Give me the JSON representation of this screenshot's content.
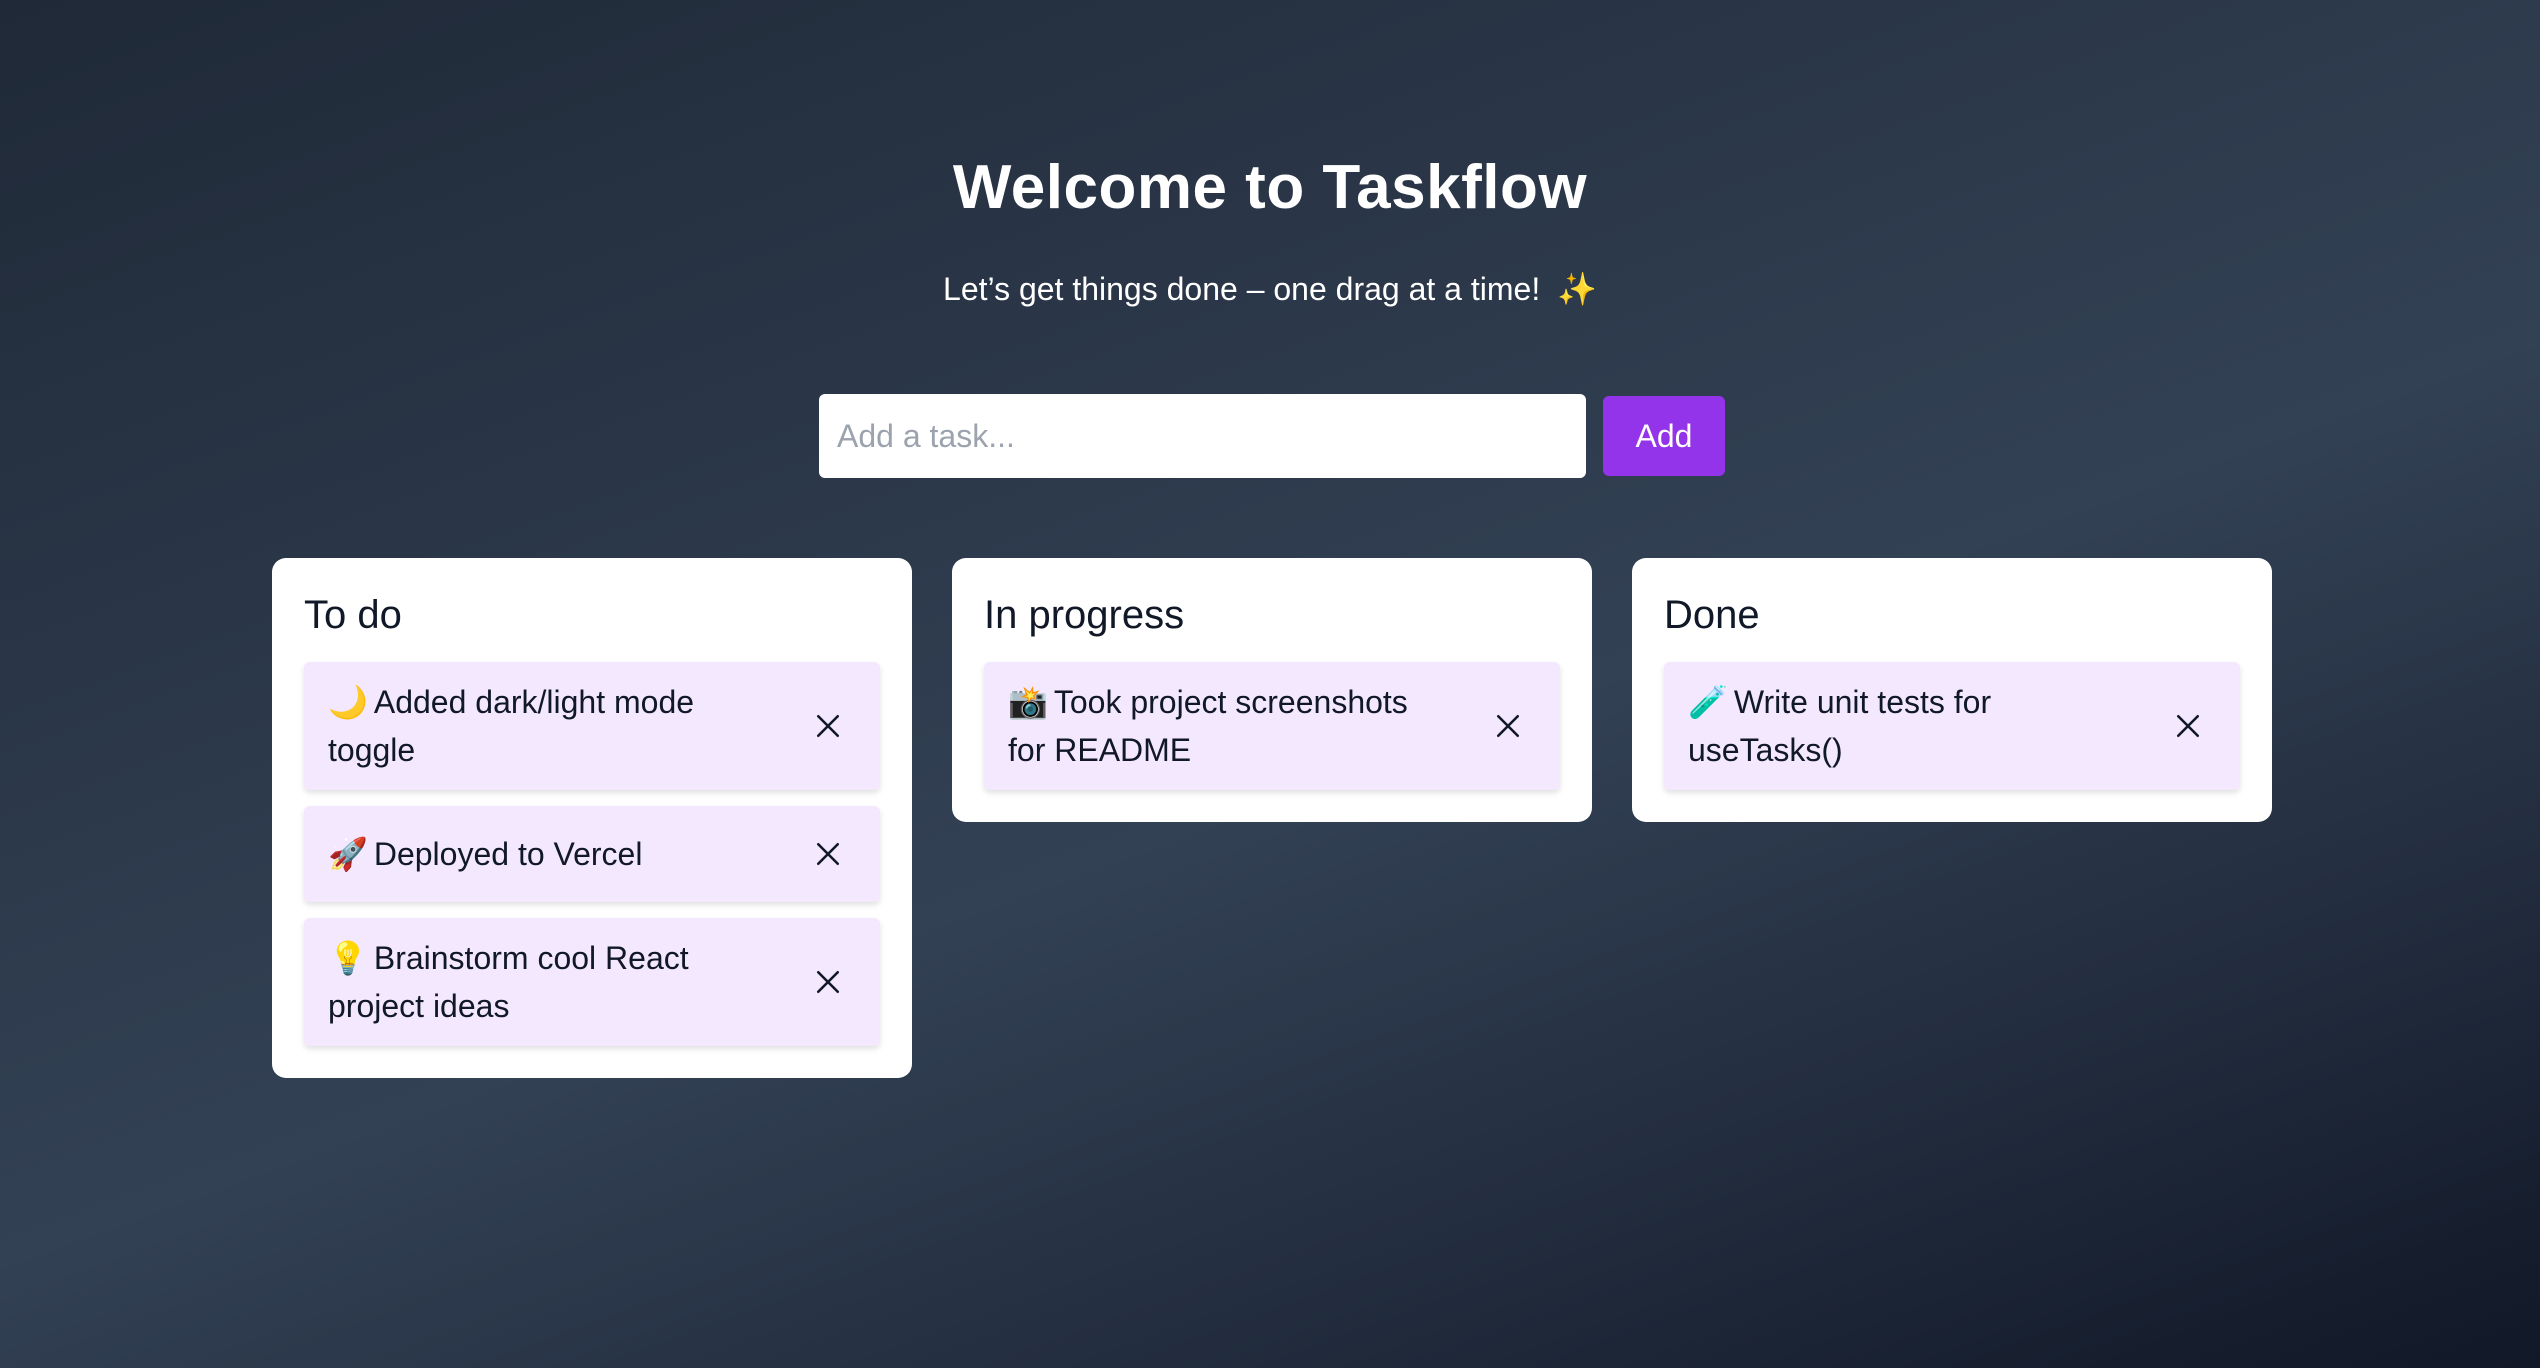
{
  "header": {
    "title": "Welcome to Taskflow",
    "subtitle": "Let’s get things done – one drag at a time!",
    "subtitle_icon": "✨"
  },
  "add_task": {
    "placeholder": "Add a task...",
    "value": "",
    "button_label": "Add"
  },
  "columns": [
    {
      "title": "To do",
      "tasks": [
        {
          "emoji": "🌙",
          "text": "Added dark/light mode toggle"
        },
        {
          "emoji": "🚀",
          "text": "Deployed to Vercel"
        },
        {
          "emoji": "💡",
          "text": "Brainstorm cool React project ideas"
        }
      ]
    },
    {
      "title": "In progress",
      "tasks": [
        {
          "emoji": "📸",
          "text": "Took project screenshots for README"
        }
      ]
    },
    {
      "title": "Done",
      "tasks": [
        {
          "emoji": "🧪",
          "text": "Write unit tests for useTasks()"
        }
      ]
    }
  ],
  "icons": {
    "delete": "close-icon",
    "sparkle": "sparkles-icon"
  },
  "colors": {
    "accent": "#9333ea",
    "card_background": "#f3e8fd",
    "column_background": "#ffffff",
    "page_gradient_start": "#1f2937",
    "page_gradient_mid": "#334155",
    "page_gradient_end": "#111827"
  }
}
